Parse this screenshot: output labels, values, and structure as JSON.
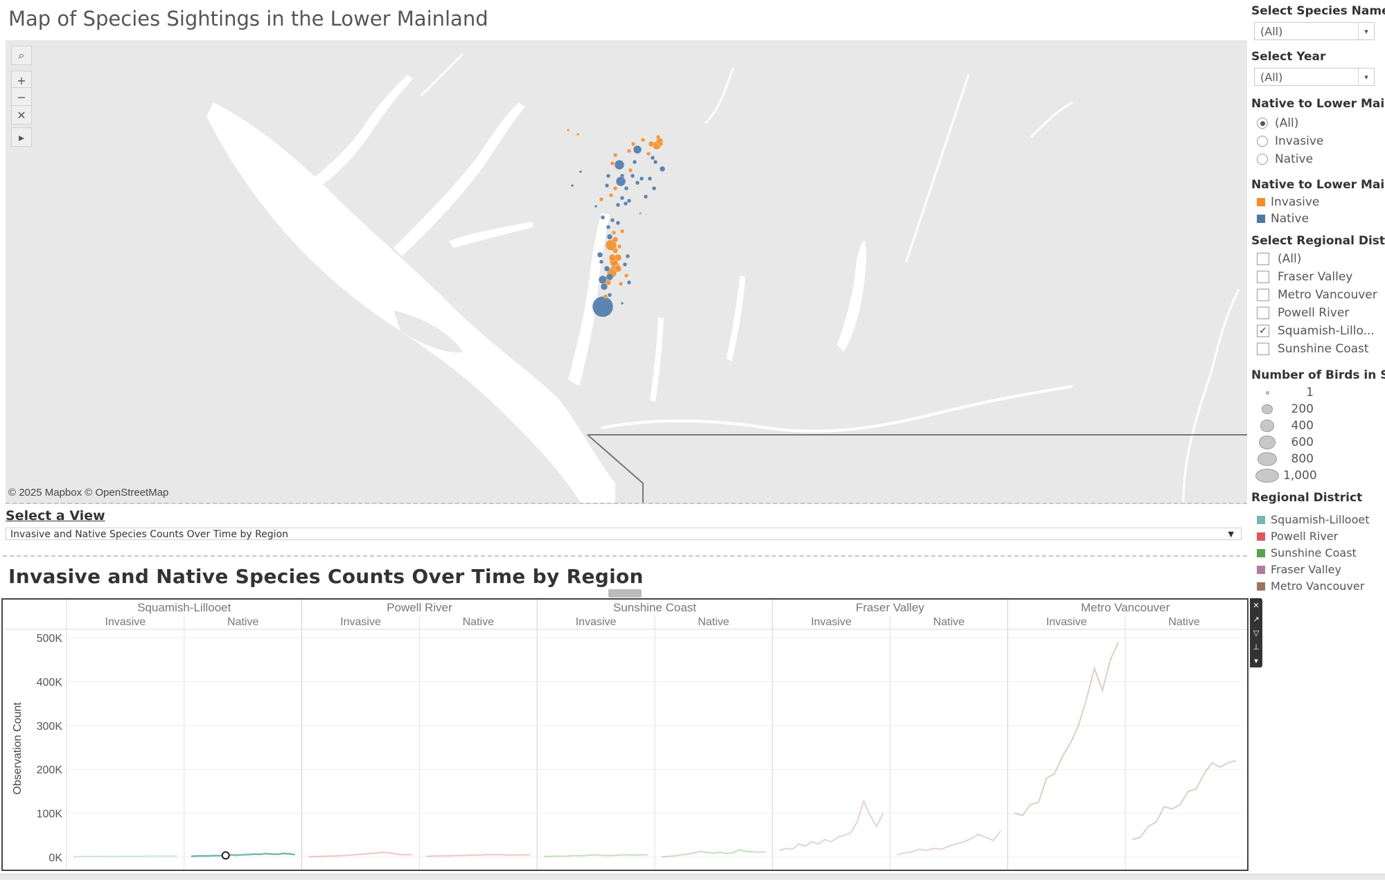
{
  "map": {
    "title": "Map of Species Sightings in the Lower Mainland",
    "credit": "© 2025 Mapbox © OpenStreetMap",
    "tools": [
      {
        "name": "search-icon",
        "glyph": "⌕"
      },
      {
        "name": "zoom-in-icon",
        "glyph": "+"
      },
      {
        "name": "zoom-out-icon",
        "glyph": "−"
      },
      {
        "name": "pin-map-icon",
        "glyph": "✕"
      },
      {
        "name": "expand-toolbar-icon",
        "glyph": "▸"
      }
    ],
    "colors": {
      "invasive": "#f28e2b",
      "native": "#4e79a7",
      "water": "#ffffff",
      "land": "#e8e8e8"
    }
  },
  "view_selector": {
    "label": "Select a View",
    "value": "Invasive and Native Species Counts Over Time by Region"
  },
  "chart_title": "Invasive and Native Species Counts Over Time by Region",
  "filters": {
    "species": {
      "label": "Select Species Name",
      "value": "(All)"
    },
    "year": {
      "label": "Select Year",
      "value": "(All)"
    },
    "native_radio": {
      "label": "Native to Lower Mai..",
      "options": [
        "(All)",
        "Invasive",
        "Native"
      ],
      "selected": "(All)"
    },
    "native_legend": {
      "label": "Native to Lower Mai..",
      "items": [
        {
          "label": "Invasive",
          "color": "#f28e2b"
        },
        {
          "label": "Native",
          "color": "#4e79a7"
        }
      ]
    },
    "region": {
      "label": "Select Regional Distr..",
      "options": [
        {
          "label": "(All)",
          "checked": false
        },
        {
          "label": "Fraser Valley",
          "checked": false
        },
        {
          "label": "Metro Vancouver",
          "checked": false
        },
        {
          "label": "Powell River",
          "checked": false
        },
        {
          "label": "Squamish-Lillo...",
          "checked": true
        },
        {
          "label": "Sunshine Coast",
          "checked": false
        }
      ]
    },
    "size_legend": {
      "label": "Number of Birds in Si..",
      "items": [
        "1",
        "200",
        "400",
        "600",
        "800",
        "1,000"
      ]
    },
    "district_legend": {
      "label": "Regional District",
      "items": [
        {
          "label": "Squamish-Lillooet",
          "color": "#76b7b2"
        },
        {
          "label": "Powell River",
          "color": "#e15759"
        },
        {
          "label": "Sunshine Coast",
          "color": "#59a14f"
        },
        {
          "label": "Fraser Valley",
          "color": "#b07aa1"
        },
        {
          "label": "Metro Vancouver",
          "color": "#9c755f"
        }
      ]
    }
  },
  "chart_data": {
    "type": "line",
    "ylabel": "Observation Count",
    "ylim": [
      0,
      500000
    ],
    "yticks": [
      "0K",
      "100K",
      "200K",
      "300K",
      "400K",
      "500K"
    ],
    "regions": [
      {
        "name": "Squamish-Lillooet",
        "color": "#76b7b2",
        "panels": [
          {
            "label": "Invasive",
            "values": [
              1000,
              1200,
              1500,
              1300,
              1800,
              1600,
              2000,
              2200,
              1900,
              2100,
              2400,
              2300,
              2600,
              2500,
              2800
            ]
          },
          {
            "label": "Native",
            "values": [
              2000,
              2500,
              3000,
              2800,
              3500,
              3200,
              4000,
              5000,
              4500,
              5500,
              6000,
              7000,
              6500,
              8000,
              7000,
              6500,
              8500,
              7500,
              6000
            ],
            "highlight": true
          }
        ]
      },
      {
        "name": "Powell River",
        "color": "#e15759",
        "panels": [
          {
            "label": "Invasive",
            "values": [
              1000,
              1500,
              2000,
              2500,
              3000,
              4000,
              5000,
              6500,
              8000,
              9000,
              11000,
              9500,
              6500,
              5500,
              6000
            ]
          },
          {
            "label": "Native",
            "values": [
              2000,
              2500,
              3000,
              2800,
              4000,
              3500,
              5000,
              4500,
              6000,
              5500,
              6000,
              4800,
              5000,
              5200,
              5500
            ]
          }
        ]
      },
      {
        "name": "Sunshine Coast",
        "color": "#59a14f",
        "panels": [
          {
            "label": "Invasive",
            "values": [
              1500,
              2000,
              2500,
              2200,
              3500,
              3000,
              4500,
              5000,
              4000,
              3500,
              4500,
              5500,
              4800,
              5000,
              5500
            ]
          },
          {
            "label": "Native",
            "values": [
              1000,
              2000,
              3000,
              5000,
              7000,
              10000,
              13000,
              11000,
              9000,
              11000,
              8000,
              10000,
              17000,
              13000,
              12000,
              11000,
              12000
            ]
          }
        ]
      },
      {
        "name": "Fraser Valley",
        "color": "#b07aa1",
        "panels": [
          {
            "label": "Invasive",
            "values": [
              15000,
              20000,
              18000,
              30000,
              25000,
              35000,
              30000,
              40000,
              35000,
              45000,
              50000,
              55000,
              80000,
              128000,
              95000,
              70000,
              100000
            ]
          },
          {
            "label": "Native",
            "values": [
              5000,
              10000,
              12000,
              18000,
              15000,
              20000,
              18000,
              25000,
              30000,
              35000,
              42000,
              52000,
              45000,
              38000,
              60000
            ]
          }
        ]
      },
      {
        "name": "Metro Vancouver",
        "color": "#9c755f",
        "panels": [
          {
            "label": "Invasive",
            "values": [
              100000,
              95000,
              120000,
              125000,
              180000,
              190000,
              230000,
              260000,
              300000,
              360000,
              430000,
              380000,
              450000,
              490000
            ]
          },
          {
            "label": "Native",
            "values": [
              40000,
              45000,
              70000,
              80000,
              115000,
              110000,
              120000,
              150000,
              155000,
              190000,
              215000,
              205000,
              215000,
              220000
            ]
          }
        ]
      }
    ]
  }
}
